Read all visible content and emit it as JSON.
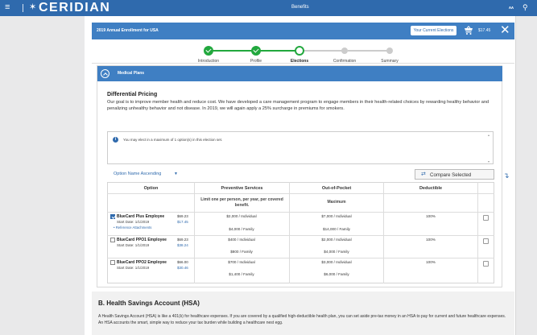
{
  "topbar": {
    "logo": "CERIDIAN",
    "title": "Benefits",
    "right_label": "ᴀᴀ"
  },
  "enrollment": {
    "title": "2019 Annual Enrollment for USA",
    "current_elections_label": "Your Current Elections",
    "cart_amount": "$17.45"
  },
  "steps": [
    {
      "label": "Introduction",
      "state": "done"
    },
    {
      "label": "Profile",
      "state": "done"
    },
    {
      "label": "Elections",
      "state": "current"
    },
    {
      "label": "Confirmation",
      "state": "todo"
    },
    {
      "label": "Summary",
      "state": "todo"
    }
  ],
  "medical": {
    "section_title": "Medical Plans",
    "diff_title": "Differential Pricing",
    "diff_text": "Our goal is to improve member health and reduce cost. We have developed a care management program to engage members in their health-related choices by rewarding healthy behavior and penalizing unhealthy behavior and not disease. In 2019, we will again apply a 25% surcharge in premiums for smokers.",
    "notice": "You may elect in a maximum of 1 option(s) in this election set.",
    "sort_label": "Option Name Ascending",
    "compare_label": "Compare Selected"
  },
  "table": {
    "headers": {
      "option": "Option",
      "preventive": "Preventive Services",
      "preventive_sub": "Limit one per person, per year, per covered benefit.",
      "oop": "Out-of-Pocket",
      "oop_sub": "Maximum",
      "deductible": "Deductible"
    },
    "rows": [
      {
        "name": "BlueCard Plus Employee",
        "start": "Start Date: 1/1/2019",
        "ref": "• Reference Attachments",
        "price1": "$69.23",
        "price2": "$17.45",
        "prev_ind": "$2,000 / Individual",
        "prev_fam": "$4,000 / Family",
        "oop_ind": "$7,000 / Individual",
        "oop_fam": "$14,000 / Family",
        "deductible": "100%",
        "selected": true
      },
      {
        "name": "BlueCard PPO1 Employee",
        "start": "Start Date: 1/1/2019",
        "ref": "",
        "price1": "$69.23",
        "price2": "$38.24",
        "prev_ind": "$400 / Individual",
        "prev_fam": "$800 / Family",
        "oop_ind": "$2,000 / Individual",
        "oop_fam": "$4,000 / Family",
        "deductible": "100%",
        "selected": false
      },
      {
        "name": "BlueCard PPO2 Employee",
        "start": "Start Date: 1/1/2019",
        "ref": "",
        "price1": "$66.00",
        "price2": "$30.46",
        "prev_ind": "$700 / Individual",
        "prev_fam": "$1,400 / Family",
        "oop_ind": "$3,000 / Individual",
        "oop_fam": "$6,000 / Family",
        "deductible": "100%",
        "selected": false
      }
    ]
  },
  "hsa": {
    "title": "B. Health Savings Account (HSA)",
    "text": "A Health Savings Account (HSA) is like a 401(k) for healthcare expenses. If you are covered by a qualified high-deductible health plan, you can set aside pre-tax money in an HSA to pay for current and future healthcare expenses. An HSA accounts the smart, simple way to reduce your tax burden while building a healthcare nest egg."
  },
  "colors": {
    "brand_blue": "#2f6aad",
    "section_blue": "#3f7fc3",
    "step_green": "#22a83e"
  }
}
